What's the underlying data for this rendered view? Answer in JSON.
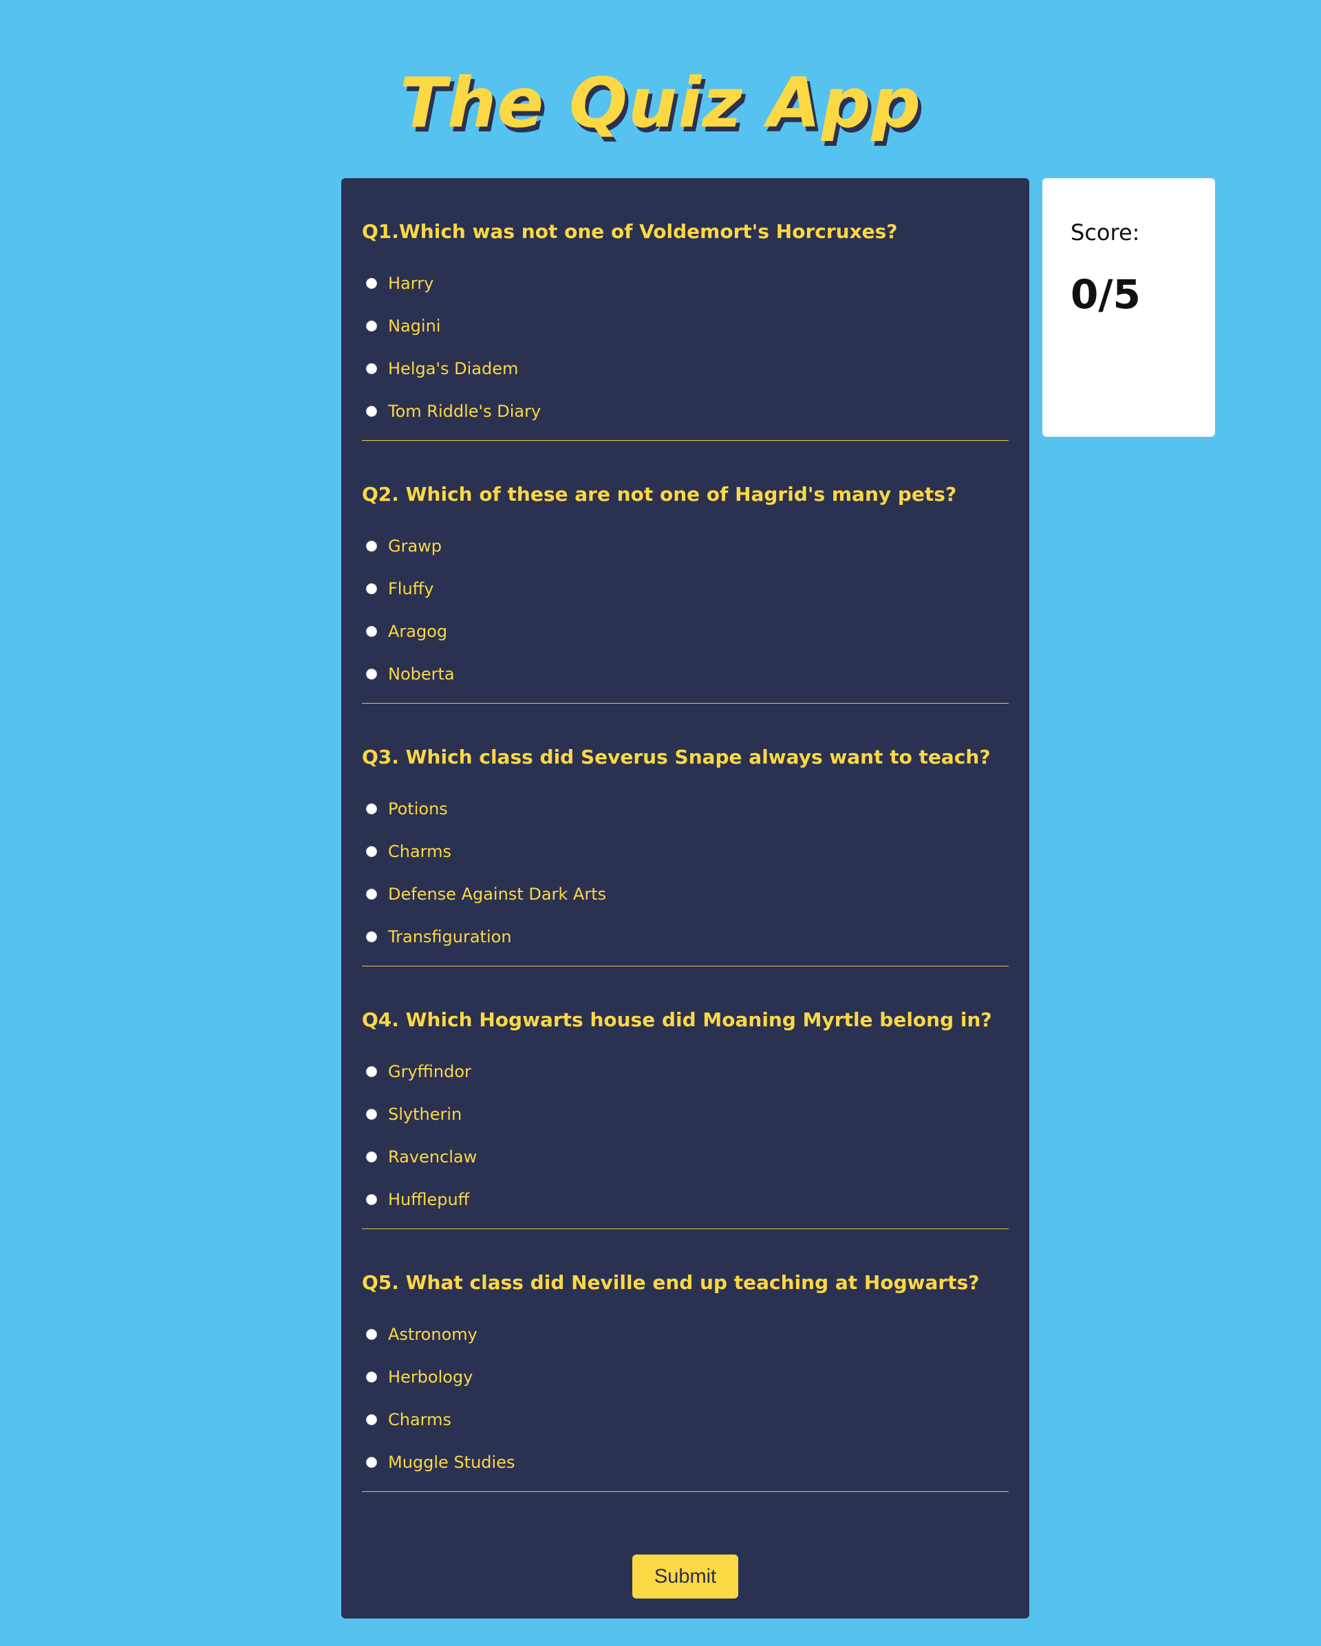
{
  "app": {
    "title": "The Quiz App"
  },
  "questions": [
    {
      "text": "Q1.Which was not one of Voldemort's Horcruxes?",
      "options": [
        "Harry",
        "Nagini",
        "Helga's Diadem",
        "Tom Riddle's Diary"
      ]
    },
    {
      "text": "Q2. Which of these are not one of Hagrid's many pets?",
      "options": [
        "Grawp",
        "Fluffy",
        "Aragog",
        "Noberta"
      ]
    },
    {
      "text": "Q3. Which class did Severus Snape always want to teach?",
      "options": [
        "Potions",
        "Charms",
        "Defense Against Dark Arts",
        "Transfiguration"
      ]
    },
    {
      "text": "Q4. Which Hogwarts house did Moaning Myrtle belong in?",
      "options": [
        "Gryffindor",
        "Slytherin",
        "Ravenclaw",
        "Hufflepuff"
      ]
    },
    {
      "text": "Q5. What class did Neville end up teaching at Hogwarts?",
      "options": [
        "Astronomy",
        "Herbology",
        "Charms",
        "Muggle Studies"
      ]
    }
  ],
  "submit": {
    "label": "Submit"
  },
  "score": {
    "label": "Score:",
    "value": "0/5"
  },
  "colors": {
    "background": "#56c2f0",
    "panel": "#2b3150",
    "accent": "#fbd844",
    "card": "#ffffff"
  }
}
